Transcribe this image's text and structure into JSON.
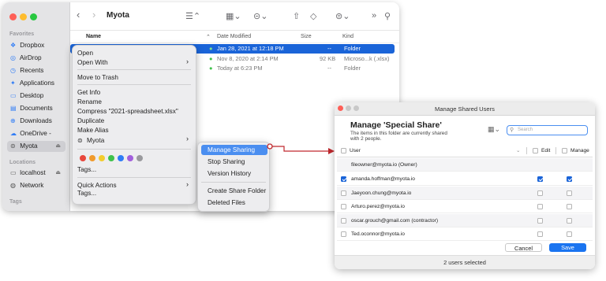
{
  "finder": {
    "title": "Myota",
    "sidebar": {
      "favorites_header": "Favorites",
      "favorites": [
        {
          "label": "Dropbox",
          "icon": "dropbox-icon"
        },
        {
          "label": "AirDrop",
          "icon": "airdrop-icon"
        },
        {
          "label": "Recents",
          "icon": "clock-icon"
        },
        {
          "label": "Applications",
          "icon": "applications-icon"
        },
        {
          "label": "Desktop",
          "icon": "desktop-icon"
        },
        {
          "label": "Documents",
          "icon": "document-icon"
        },
        {
          "label": "Downloads",
          "icon": "download-icon"
        },
        {
          "label": "OneDrive -",
          "icon": "cloud-icon"
        },
        {
          "label": "Myota",
          "icon": "myota-icon"
        }
      ],
      "locations_header": "Locations",
      "locations": [
        {
          "label": "localhost",
          "icon": "monitor-icon"
        },
        {
          "label": "Network",
          "icon": "network-icon"
        }
      ],
      "tags_header": "Tags"
    },
    "columns": {
      "name": "Name",
      "date": "Date Modified",
      "size": "Size",
      "kind": "Kind"
    },
    "rows": [
      {
        "date": "Jan 28, 2021 at 12:18 PM",
        "size": "--",
        "kind": "Folder"
      },
      {
        "date": "Nov 8, 2020 at 2:14 PM",
        "size": "92 KB",
        "kind": "Microso...k (.xlsx)"
      },
      {
        "date": "Today at 6:23 PM",
        "size": "--",
        "kind": "Folder"
      }
    ]
  },
  "context_menu": {
    "open": "Open",
    "open_with": "Open With",
    "move_to_trash": "Move to Trash",
    "get_info": "Get Info",
    "rename": "Rename",
    "compress": "Compress \"2021-spreadsheet.xlsx\"",
    "duplicate": "Duplicate",
    "make_alias": "Make Alias",
    "myota": "Myota",
    "tags": "Tags...",
    "quick_actions": "Quick Actions",
    "tags2": "Tags...",
    "tag_colors": [
      "#e8473c",
      "#f09a2c",
      "#f3cc2d",
      "#3fc24b",
      "#2f7cf6",
      "#a25fdc",
      "#9a9a9e"
    ]
  },
  "submenu": {
    "items": [
      "Manage Sharing",
      "Stop Sharing",
      "Version History",
      "Create Share Folder",
      "Deleted Files"
    ]
  },
  "dialog": {
    "window_title": "Manage Shared Users",
    "heading": "Manage 'Special Share'",
    "subtitle_line1": "The items in this folder are currently shared",
    "subtitle_line2": "with 2 people.",
    "search_placeholder": "Search",
    "col_user": "User",
    "col_edit": "Edit",
    "col_manage": "Manage",
    "owner": "fileowner@myota.io (Owner)",
    "users": [
      {
        "email": "amanda.hoffman@myota.io",
        "selected": true,
        "edit": true,
        "manage": true
      },
      {
        "email": "Jaeyoon.chung@myota.io",
        "selected": false,
        "edit": false,
        "manage": false
      },
      {
        "email": "Arturo.perez@myota.io",
        "selected": false,
        "edit": false,
        "manage": false
      },
      {
        "email": "oscar.grouch@gmail.com (contractor)",
        "selected": false,
        "edit": false,
        "manage": false
      },
      {
        "email": "Ted.oconnor@myota.io",
        "selected": false,
        "edit": false,
        "manage": false
      }
    ],
    "cancel": "Cancel",
    "save": "Save",
    "status": "2 users selected"
  }
}
